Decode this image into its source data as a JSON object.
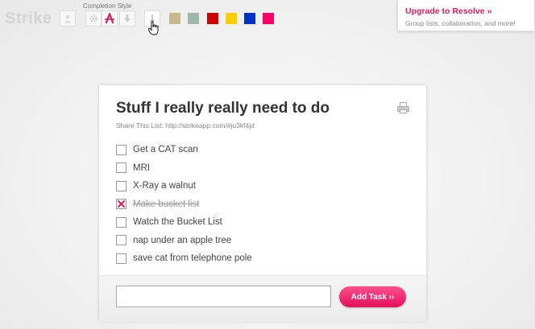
{
  "header": {
    "brand": "Strike",
    "completion_style_label": "Completion Style",
    "swatches": [
      "#c8b88e",
      "#9fb8a8",
      "#cc0000",
      "#ffcc00",
      "#0033cc",
      "#ff0066"
    ]
  },
  "upgrade": {
    "title": "Upgrade to Resolve »",
    "subtitle": "Group lists, collaboration, and more!"
  },
  "list": {
    "title": "Stuff I really really need to do",
    "share_text": "Share This List: http://strikeapp.com/#ju3kf4jd",
    "tasks": [
      {
        "text": "Get a CAT scan",
        "done": false
      },
      {
        "text": "MRI",
        "done": false
      },
      {
        "text": "X-Ray a walnut",
        "done": false
      },
      {
        "text": "Make bucket list",
        "done": true
      },
      {
        "text": "Watch the Bucket List",
        "done": false
      },
      {
        "text": "nap under an apple tree",
        "done": false
      },
      {
        "text": "save cat from telephone pole",
        "done": false
      }
    ]
  },
  "add_task": {
    "input_value": "",
    "button_label": "Add Task ››"
  },
  "colors": {
    "accent": "#e0195c",
    "check": "#e0195c"
  }
}
